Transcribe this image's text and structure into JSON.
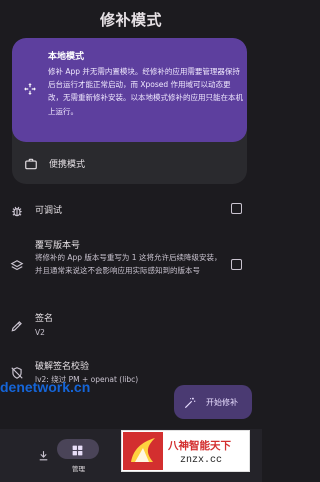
{
  "app": {
    "title": "修补模式"
  },
  "mode_card": {
    "local": {
      "title": "本地模式",
      "description": "修补 App 并无需内置模块。经修补的应用需要管理器保持后台运行才能正常启动，而 Xposed 作用域可以动态更改，无需重新修补安装。以本地模式修补的应用只能在本机上运行。",
      "icon": "move-arrows-icon"
    },
    "portable": {
      "title": "便携模式",
      "icon": "briefcase-icon"
    }
  },
  "settings": [
    {
      "title": "可调试",
      "icon": "bug-icon",
      "checked": false
    },
    {
      "title": "覆写版本号",
      "description": "将修补的 App 版本号重写为 1 这将允许后续降级安装，并且通常来说这不会影响应用实际感知到的版本号",
      "icon": "layers-icon",
      "checked": false
    },
    {
      "title": "签名",
      "value": "V2",
      "icon": "pen-icon"
    },
    {
      "title": "破解签名校验",
      "value": "lv2: 绕过 PM + openat (libc)",
      "icon": "shield-off-icon"
    }
  ],
  "fab": {
    "label": "开始修补",
    "icon": "magic-wand-icon"
  },
  "nav": {
    "items": [
      {
        "label": "",
        "icon": "download-icon",
        "active": false
      },
      {
        "label": "管理",
        "icon": "grid-icon",
        "active": true
      }
    ]
  },
  "watermarks": {
    "site": "denetwork.cn",
    "overlay_title": "八神智能天下",
    "overlay_domain": "znzx.cc"
  },
  "colors": {
    "background": "#1c1b1f",
    "accent": "#5d3f9e",
    "fab": "#4a3a72",
    "watermark_blue": "#1565d8",
    "watermark_red": "#d32f2f"
  }
}
